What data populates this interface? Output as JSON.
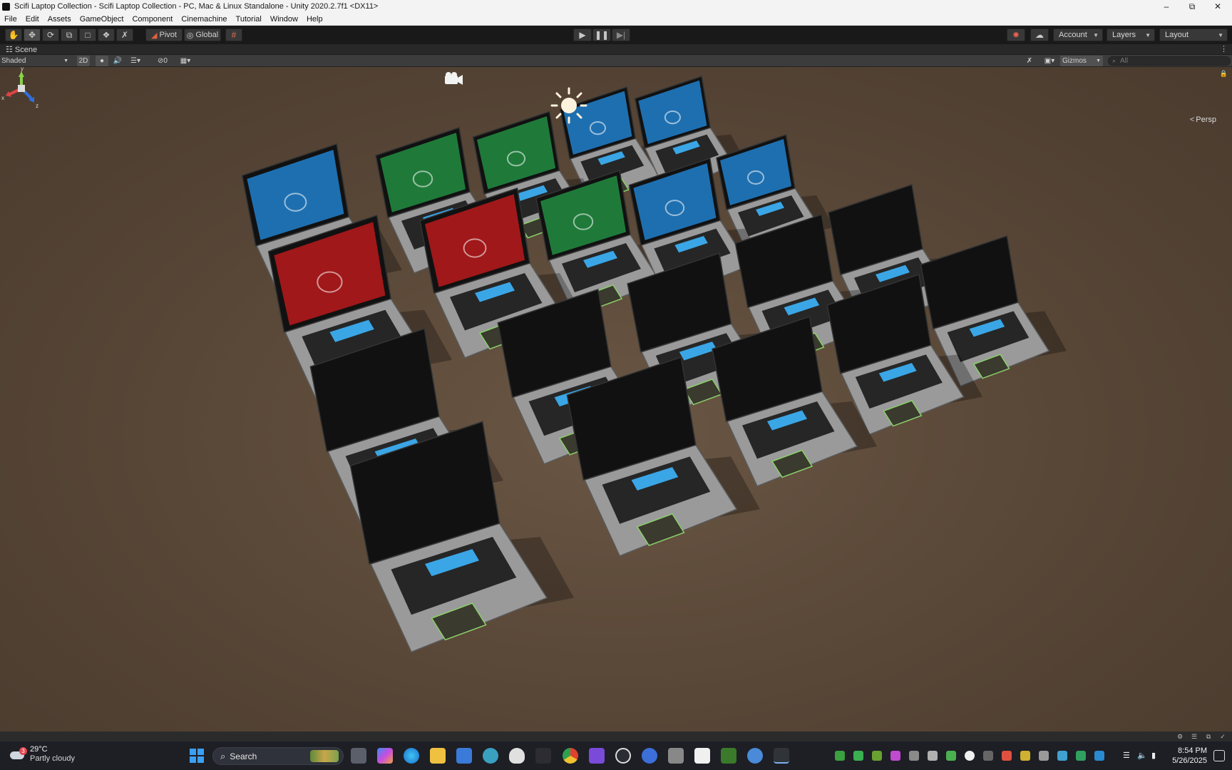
{
  "window": {
    "title": "Scifi Laptop Collection - Scifi Laptop Collection - PC, Mac & Linux Standalone - Unity 2020.2.7f1 <DX11>",
    "controls": [
      "minimize-icon",
      "restore-icon",
      "close-icon"
    ]
  },
  "menu": {
    "items": [
      "File",
      "Edit",
      "Assets",
      "GameObject",
      "Component",
      "Cinemachine",
      "Tutorial",
      "Window",
      "Help"
    ]
  },
  "toolbar": {
    "tools": [
      "hand-tool-icon",
      "move-tool-icon",
      "rotate-tool-icon",
      "scale-tool-icon",
      "rect-tool-icon",
      "transform-tool-icon",
      "custom-tool-icon"
    ],
    "active_tool": "move-tool-icon",
    "pivot_label": "Pivot",
    "global_label": "Global",
    "account_label": "Account",
    "layers_label": "Layers",
    "layout_label": "Layout"
  },
  "scene_tab": {
    "label": "Scene"
  },
  "scene_controls": {
    "shading_mode": "Shaded",
    "mode_2d": "2D",
    "hidden_count": "0",
    "gizmos_label": "Gizmos",
    "search_placeholder": "All"
  },
  "viewport": {
    "projection_label": "Persp",
    "axis_labels": {
      "x": "x",
      "y": "y",
      "z": "z"
    },
    "background_color": "#5a4838",
    "screen_colors": {
      "blue": "#1e6fb0",
      "green": "#1f7a3a",
      "red": "#a0181a",
      "dark": "#121212"
    }
  },
  "taskbar": {
    "weather_temp": "29°C",
    "weather_condition": "Partly cloudy",
    "weather_badge": "3",
    "search_label": "Search",
    "time": "8:54 PM",
    "date": "5/26/2025"
  }
}
